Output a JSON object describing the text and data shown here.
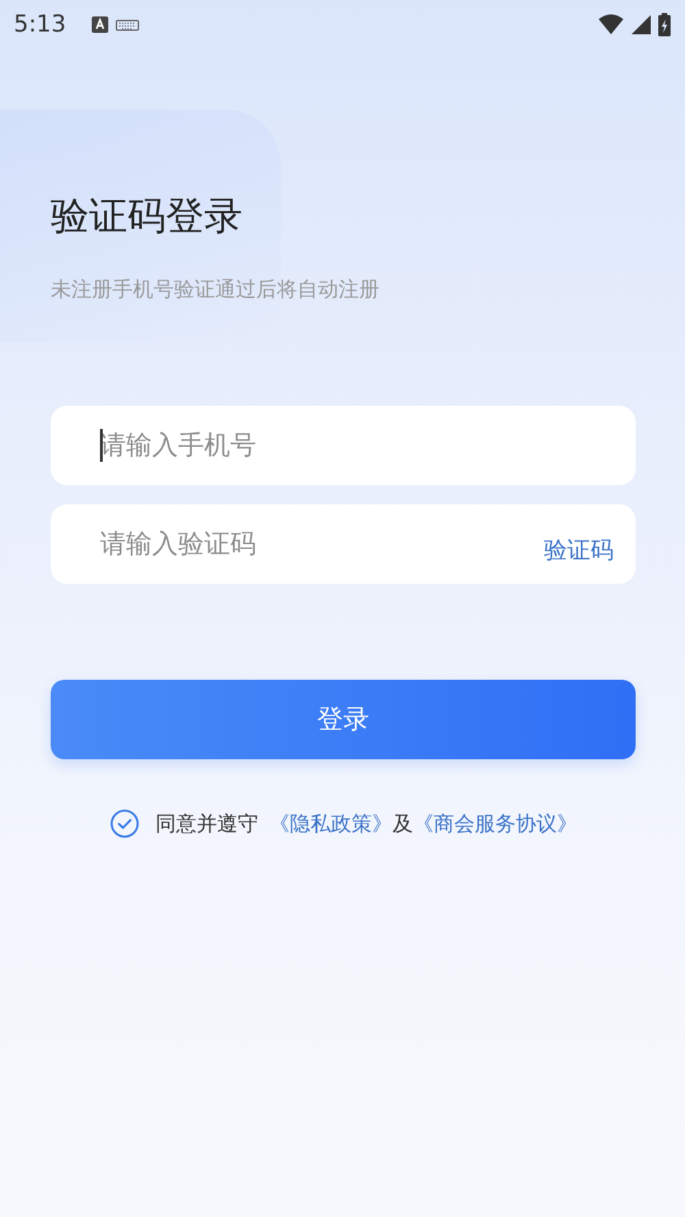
{
  "status_bar": {
    "time": "5:13"
  },
  "title": "验证码登录",
  "subtitle": "未注册手机号验证通过后将自动注册",
  "phone_field": {
    "placeholder": "请输入手机号",
    "focused": true
  },
  "code_field": {
    "placeholder": "请输入验证码",
    "action": "验证码"
  },
  "login_button": "登录",
  "agreement": {
    "checked": true,
    "prefix": "同意并遵守",
    "joiner": "及",
    "links": [
      "《隐私政策》",
      "《商会服务协议》"
    ]
  }
}
